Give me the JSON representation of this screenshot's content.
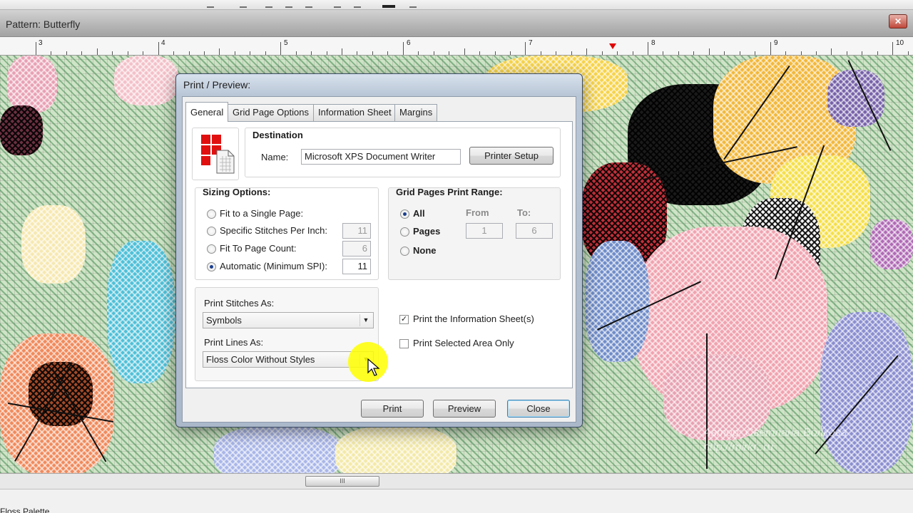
{
  "pattern_window": {
    "title": "Pattern: Butterfly",
    "close_icon": "close-icon"
  },
  "ruler": {
    "labels": [
      "3",
      "4",
      "5",
      "6",
      "7",
      "8",
      "9",
      "10"
    ]
  },
  "watermark": {
    "line1": "Автор: Светлана Волкова",
    "line2": "http://mirkr..ru"
  },
  "bottom_panel": {
    "title": "Floss Palette",
    "scroll_grip": "III"
  },
  "dialog": {
    "title": "Print / Preview:",
    "tabs": [
      {
        "label": "General",
        "active": true
      },
      {
        "label": "Grid Page Options",
        "active": false
      },
      {
        "label": "Information Sheet",
        "active": false
      },
      {
        "label": "Margins",
        "active": false
      }
    ],
    "destination": {
      "title": "Destination",
      "name_label": "Name:",
      "printer_name": "Microsoft XPS Document Writer",
      "printer_setup_label": "Printer Setup"
    },
    "sizing": {
      "title": "Sizing Options:",
      "options": [
        {
          "label": "Fit to a Single Page:",
          "checked": false,
          "value": ""
        },
        {
          "label": "Specific Stitches Per Inch:",
          "checked": false,
          "value": "11"
        },
        {
          "label": "Fit To Page Count:",
          "checked": false,
          "value": "6"
        },
        {
          "label": "Automatic (Minimum SPI):",
          "checked": true,
          "value": "11"
        }
      ]
    },
    "grid_range": {
      "title": "Grid Pages Print Range:",
      "options": [
        {
          "label": "All",
          "checked": true
        },
        {
          "label": "Pages",
          "checked": false
        },
        {
          "label": "None",
          "checked": false
        }
      ],
      "from_label": "From",
      "to_label": "To:",
      "from_value": "1",
      "to_value": "6"
    },
    "print_stitches": {
      "label": "Print Stitches As:",
      "value": "Symbols"
    },
    "print_lines": {
      "label": "Print Lines As:",
      "value": "Floss Color Without Styles"
    },
    "checkboxes": [
      {
        "label": "Print the Information Sheet(s)",
        "checked": true
      },
      {
        "label": "Print Selected Area Only",
        "checked": false
      }
    ],
    "buttons": {
      "print": "Print",
      "preview": "Preview",
      "close": "Close"
    }
  }
}
